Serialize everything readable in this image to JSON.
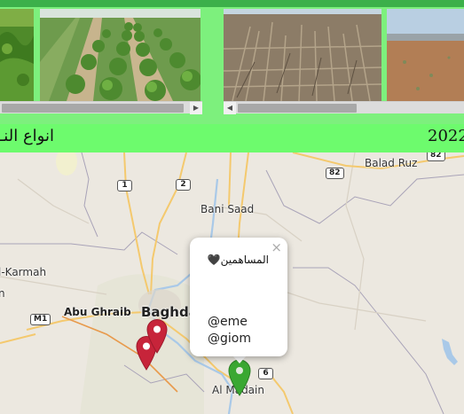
{
  "gallery": {
    "photos": [
      {
        "name": "vineyard-photo"
      },
      {
        "name": "tree-rows-photo"
      },
      {
        "name": "dry-field-photo"
      },
      {
        "name": "bare-land-photo"
      }
    ]
  },
  "banner": {
    "title": "انواع النـ",
    "year": "2022"
  },
  "map": {
    "places": {
      "balad_ruz": "Balad Ruz",
      "bani_saad": "Bani Saad",
      "al_karmah": "l-Karmah",
      "abu_ghraib": "Abu Ghraib",
      "baghdad": "Baghdad",
      "al_madain": "Al Madain",
      "partial_n": "n"
    },
    "routes": {
      "r82a": "82",
      "r82b": "82",
      "r1": "1",
      "r2": "2",
      "m1": "M1",
      "r6": "6"
    }
  },
  "popup": {
    "close": "×",
    "title": "المساهمين🖤",
    "users": [
      "@eme",
      "@giom"
    ]
  },
  "colors": {
    "banner": "#6dfb6d",
    "top_bar": "#3cb04a",
    "marker_red": "#c7243a",
    "marker_green": "#3aa832"
  }
}
